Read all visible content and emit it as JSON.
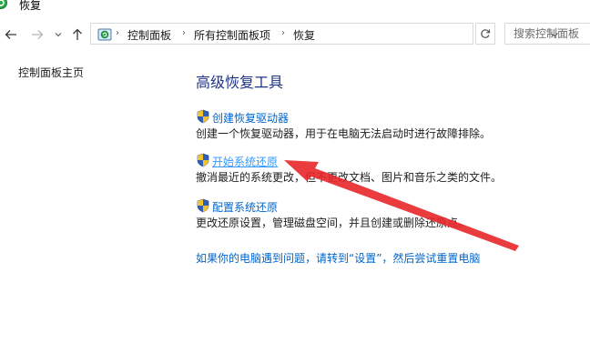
{
  "window": {
    "title": "恢复"
  },
  "address_bar": {
    "segments": [
      "控制面板",
      "所有控制面板项",
      "恢复"
    ]
  },
  "search": {
    "placeholder": "搜索控制面板"
  },
  "sidebar": {
    "home_link": "控制面板主页"
  },
  "main": {
    "heading": "高级恢复工具",
    "items": [
      {
        "label": "创建恢复驱动器",
        "description": "创建一个恢复驱动器，用于在电脑无法启动时进行故障排除。"
      },
      {
        "label": "开始系统还原",
        "description": "撤消最近的系统更改，但不更改文档、图片和音乐之类的文件。"
      },
      {
        "label": "配置系统还原",
        "description": "更改还原设置，管理磁盘空间，并且创建或删除还原点。"
      }
    ],
    "reset_link": "如果你的电脑遇到问题，请转到“设置”，然后尝试重置电脑"
  },
  "colors": {
    "link": "#0066cc",
    "heading": "#1e3287",
    "annotation_arrow": "#e8272a"
  }
}
